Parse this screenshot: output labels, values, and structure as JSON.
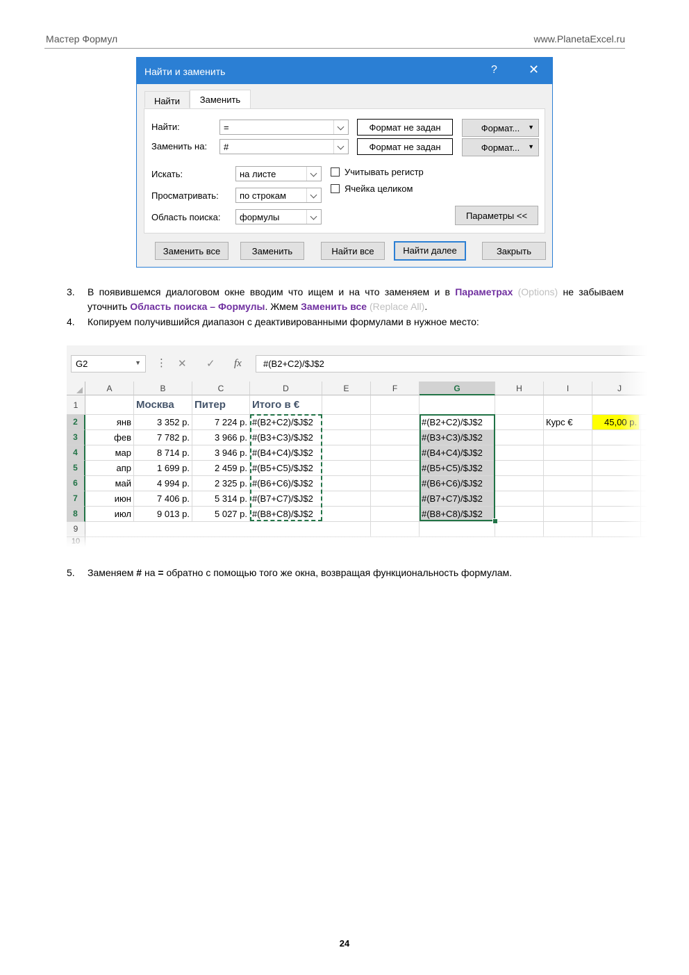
{
  "header": {
    "left": "Мастер Формул",
    "right": "www.PlanetaExcel.ru"
  },
  "dialog": {
    "title": "Найти и заменить",
    "help": "?",
    "close": "✕",
    "tabs": [
      "Найти",
      "Заменить"
    ],
    "find_label": "Найти:",
    "find_value": "=",
    "replace_label": "Заменить на:",
    "replace_value": "#",
    "format_status": "Формат не задан",
    "format_button": "Формат...",
    "within_label": "Искать:",
    "within_value": "на листе",
    "search_label": "Просматривать:",
    "search_value": "по строкам",
    "lookin_label": "Область поиска:",
    "lookin_value": "формулы",
    "match_case": "Учитывать регистр",
    "match_cell": "Ячейка целиком",
    "options_button": "Параметры <<",
    "buttons": [
      "Заменить все",
      "Заменить",
      "Найти все",
      "Найти далее",
      "Закрыть"
    ]
  },
  "steps": [
    {
      "num": "3.",
      "parts": [
        {
          "t": "В появившемся диалоговом окне вводим что ищем и на что заменяем и в ",
          "s": ""
        },
        {
          "t": "Параметрах",
          "s": "purple"
        },
        {
          "t": " ",
          "s": ""
        },
        {
          "t": "(Options)",
          "s": "grey"
        },
        {
          "t": " не забываем уточнить ",
          "s": ""
        },
        {
          "t": "Область поиска – Формулы",
          "s": "purple"
        },
        {
          "t": ". Жмем ",
          "s": ""
        },
        {
          "t": "Заменить все",
          "s": "purple"
        },
        {
          "t": " ",
          "s": ""
        },
        {
          "t": "(Replace All)",
          "s": "grey"
        },
        {
          "t": ".",
          "s": ""
        }
      ]
    },
    {
      "num": "4.",
      "text": "Копируем получившийся диапазон с деактивированными формулами в нужное место:"
    },
    {
      "num": "5.",
      "text_a": "Заменяем ",
      "bold1": "#",
      "text_b": " на ",
      "bold2": "=",
      "text_c": " обратно с помощью того же окна, возвращая функциональность формулам."
    }
  ],
  "sheet": {
    "name_box": "G2",
    "formula": "#(B2+C2)/$J$2",
    "fx": "fx",
    "columns": [
      "A",
      "B",
      "C",
      "D",
      "E",
      "F",
      "G",
      "H",
      "I",
      "J"
    ],
    "rows": [
      "1",
      "2",
      "3",
      "4",
      "5",
      "6",
      "7",
      "8",
      "9",
      "10"
    ],
    "headers": {
      "B": "Москва",
      "C": "Питер",
      "D": "Итого в €"
    },
    "data": [
      [
        "янв",
        "3 352 р.",
        "7 224 р.",
        "#(B2+C2)/$J$2"
      ],
      [
        "фев",
        "7 782 р.",
        "3 966 р.",
        "#(B3+C3)/$J$2"
      ],
      [
        "мар",
        "8 714 р.",
        "3 946 р.",
        "#(B4+C4)/$J$2"
      ],
      [
        "апр",
        "1 699 р.",
        "2 459 р.",
        "#(B5+C5)/$J$2"
      ],
      [
        "май",
        "4 994 р.",
        "2 325 р.",
        "#(B6+C6)/$J$2"
      ],
      [
        "июн",
        "7 406 р.",
        "5 314 р.",
        "#(B7+C7)/$J$2"
      ],
      [
        "июл",
        "9 013 р.",
        "5 027 р.",
        "#(B8+C8)/$J$2"
      ]
    ],
    "g_column": [
      "#(B2+C2)/$J$2",
      "#(B3+C3)/$J$2",
      "#(B4+C4)/$J$2",
      "#(B5+C5)/$J$2",
      "#(B6+C6)/$J$2",
      "#(B7+C7)/$J$2",
      "#(B8+C8)/$J$2"
    ],
    "rate_label": "Курс €",
    "rate_value": "45,00 р.",
    "colors": {
      "accent": "#217346",
      "highlight": "#ffff00",
      "header_text": "#44546a"
    }
  },
  "page_number": "24"
}
